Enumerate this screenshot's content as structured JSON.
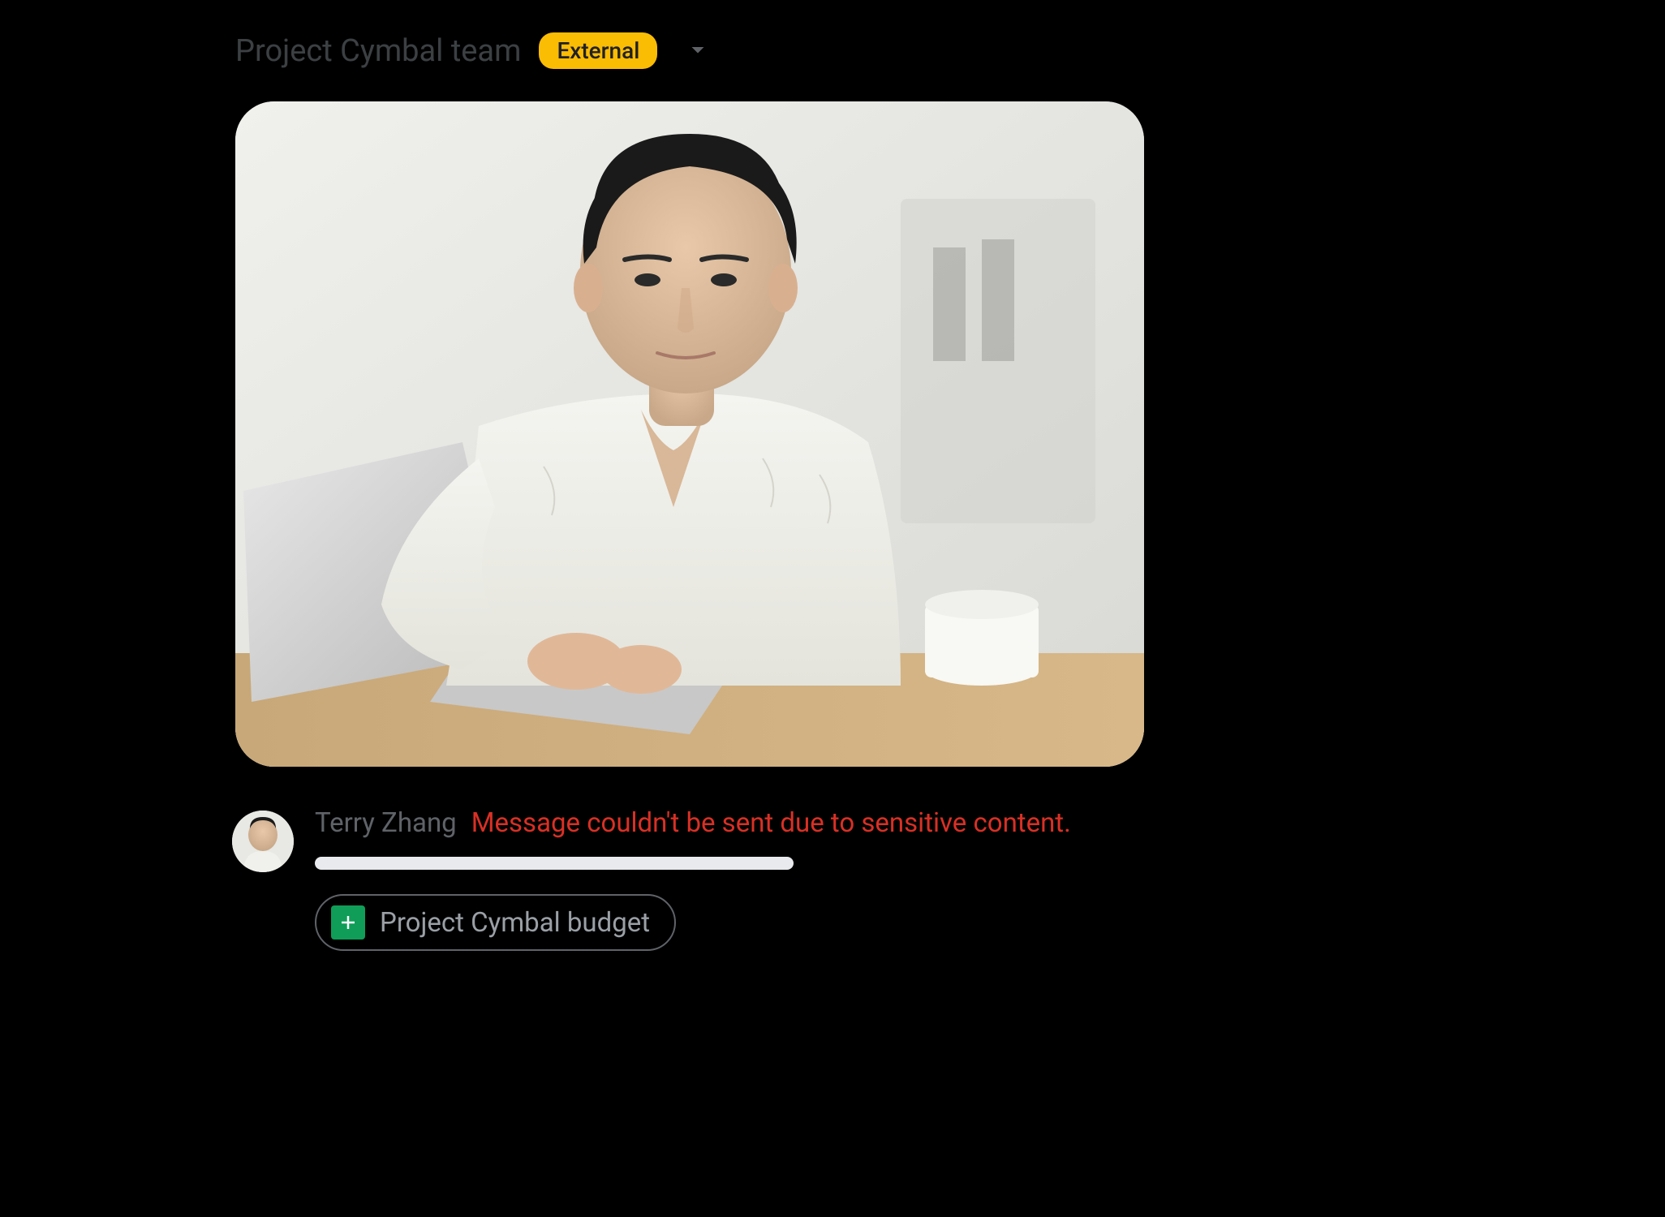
{
  "header": {
    "space_title": "Project Cymbal team",
    "badge_label": "External"
  },
  "message": {
    "sender_name": "Terry Zhang",
    "error_text": "Message couldn't be sent due to sensitive content."
  },
  "attachment": {
    "file_name": "Project Cymbal budget",
    "file_type": "google-sheets"
  },
  "colors": {
    "badge_bg": "#fbbc04",
    "error": "#d93025",
    "sheets_green": "#0f9d58"
  }
}
